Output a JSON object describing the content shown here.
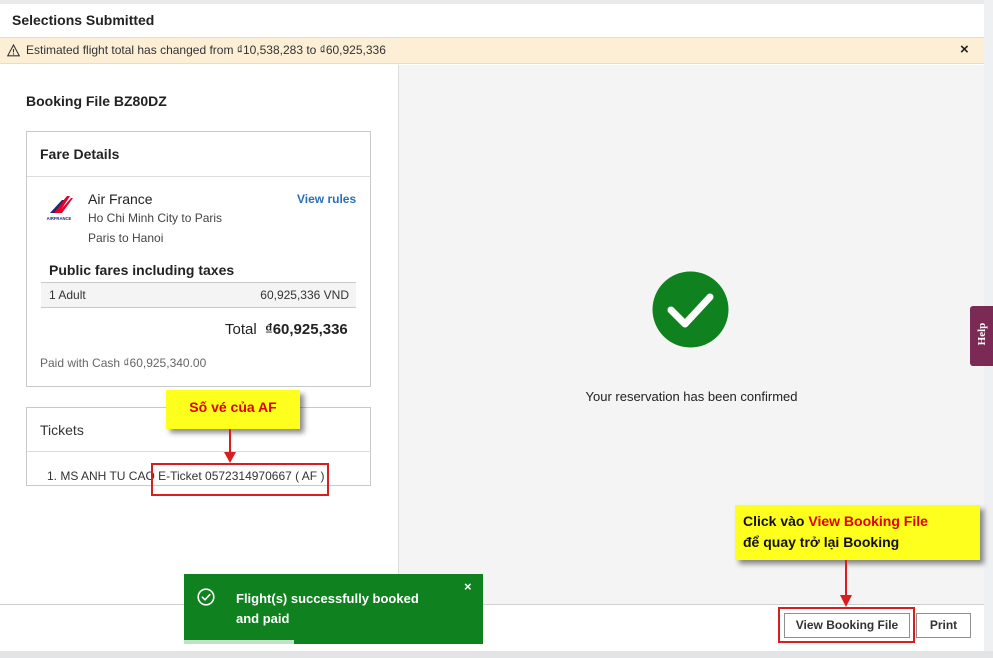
{
  "header": {
    "title": "Selections Submitted"
  },
  "alert": {
    "text": "Estimated flight total has changed from ₫10,538,283 to ₫60,925,336",
    "close_label": "×",
    "color": "#fcefd6"
  },
  "booking": {
    "title": "Booking File BZ80DZ"
  },
  "fare_details": {
    "title": "Fare Details",
    "airline": "Air France",
    "logo_text": "AIRFRANCE",
    "routes": [
      "Ho Chi Minh City to Paris",
      "Paris to Hanoi"
    ],
    "view_rules_label": "View rules",
    "public_fares_title": "Public fares including taxes",
    "rows": [
      {
        "pax": "1 Adult",
        "amount": "60,925,336 VND"
      }
    ],
    "total_label": "Total",
    "total_value": "₫60,925,336",
    "paid_with": "Paid with Cash ₫60,925,340.00"
  },
  "tickets": {
    "title": "Tickets",
    "items": [
      "1. MS ANH TU CAO E-Ticket 0572314970667 ( AF )"
    ]
  },
  "confirmation": {
    "text": "Your reservation has been confirmed",
    "icon": "check-circle-icon",
    "color": "#10811f"
  },
  "help": {
    "label": "Help",
    "color": "#7a2a54"
  },
  "toast": {
    "line1": "Flight(s) successfully booked",
    "line2": "and paid",
    "close_label": "×",
    "color": "#10811f"
  },
  "footer": {
    "view_booking_label": "View Booking File",
    "print_label": "Print"
  },
  "annotations": {
    "ticket_callout": "Số vé của AF",
    "booking_callout_prefix": "Click vào ",
    "booking_callout_highlight": "View Booking File",
    "booking_callout_line2": "để quay trở lại Booking",
    "callout_color": "#ffff1e",
    "highlight_color": "#d81e1e"
  }
}
